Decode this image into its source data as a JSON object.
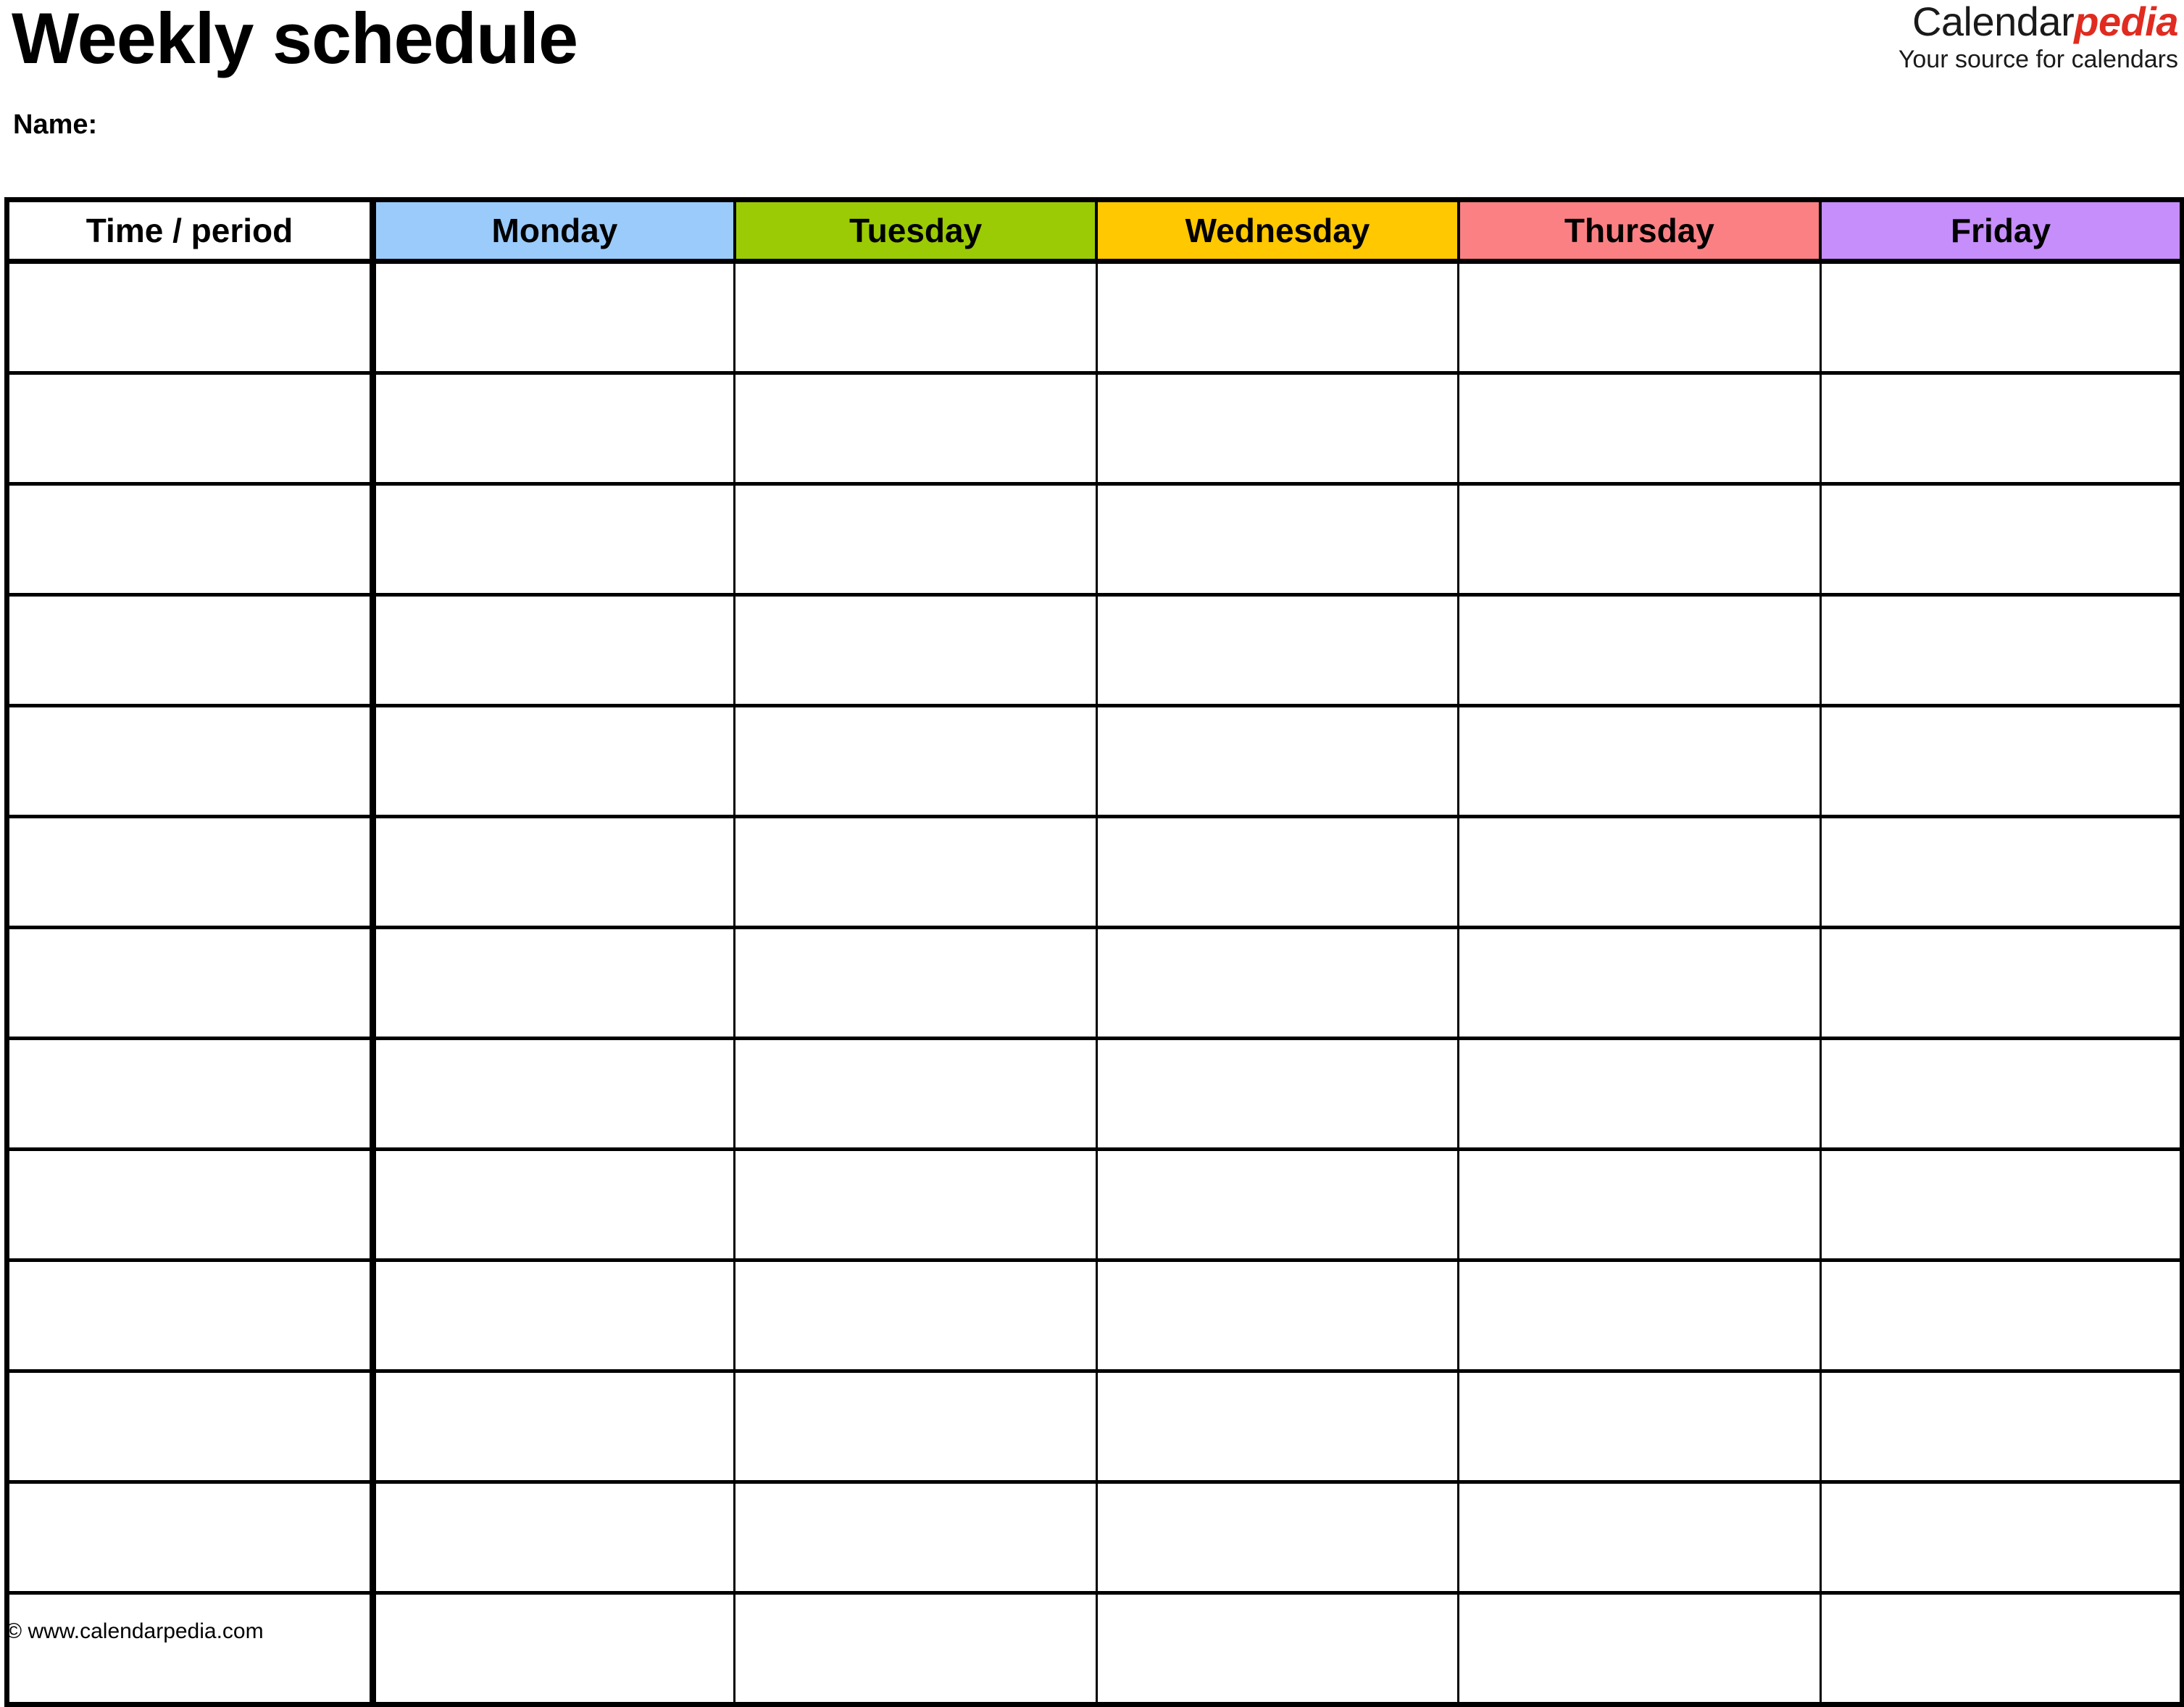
{
  "document": {
    "title": "Weekly schedule",
    "name_label": "Name:"
  },
  "brand": {
    "name_part_1": "Calendar",
    "name_part_2": "pedia",
    "tagline": "Your source for calendars",
    "accent_color": "#e02b20"
  },
  "table": {
    "columns": [
      {
        "label": "Time / period",
        "color": "#ffffff",
        "key": "time"
      },
      {
        "label": "Monday",
        "color": "#9BCBFB",
        "key": "monday"
      },
      {
        "label": "Tuesday",
        "color": "#9BCB04",
        "key": "tuesday"
      },
      {
        "label": "Wednesday",
        "color": "#FFC800",
        "key": "wednesday"
      },
      {
        "label": "Thursday",
        "color": "#FB8084",
        "key": "thursday"
      },
      {
        "label": "Friday",
        "color": "#C68EFA",
        "key": "friday"
      }
    ],
    "row_count": 13,
    "rows": [
      {
        "time": "",
        "monday": "",
        "tuesday": "",
        "wednesday": "",
        "thursday": "",
        "friday": ""
      },
      {
        "time": "",
        "monday": "",
        "tuesday": "",
        "wednesday": "",
        "thursday": "",
        "friday": ""
      },
      {
        "time": "",
        "monday": "",
        "tuesday": "",
        "wednesday": "",
        "thursday": "",
        "friday": ""
      },
      {
        "time": "",
        "monday": "",
        "tuesday": "",
        "wednesday": "",
        "thursday": "",
        "friday": ""
      },
      {
        "time": "",
        "monday": "",
        "tuesday": "",
        "wednesday": "",
        "thursday": "",
        "friday": ""
      },
      {
        "time": "",
        "monday": "",
        "tuesday": "",
        "wednesday": "",
        "thursday": "",
        "friday": ""
      },
      {
        "time": "",
        "monday": "",
        "tuesday": "",
        "wednesday": "",
        "thursday": "",
        "friday": ""
      },
      {
        "time": "",
        "monday": "",
        "tuesday": "",
        "wednesday": "",
        "thursday": "",
        "friday": ""
      },
      {
        "time": "",
        "monday": "",
        "tuesday": "",
        "wednesday": "",
        "thursday": "",
        "friday": ""
      },
      {
        "time": "",
        "monday": "",
        "tuesday": "",
        "wednesday": "",
        "thursday": "",
        "friday": ""
      },
      {
        "time": "",
        "monday": "",
        "tuesday": "",
        "wednesday": "",
        "thursday": "",
        "friday": ""
      },
      {
        "time": "",
        "monday": "",
        "tuesday": "",
        "wednesday": "",
        "thursday": "",
        "friday": ""
      },
      {
        "time": "",
        "monday": "",
        "tuesday": "",
        "wednesday": "",
        "thursday": "",
        "friday": ""
      }
    ]
  },
  "footer": {
    "copyright": "© www.calendarpedia.com"
  }
}
